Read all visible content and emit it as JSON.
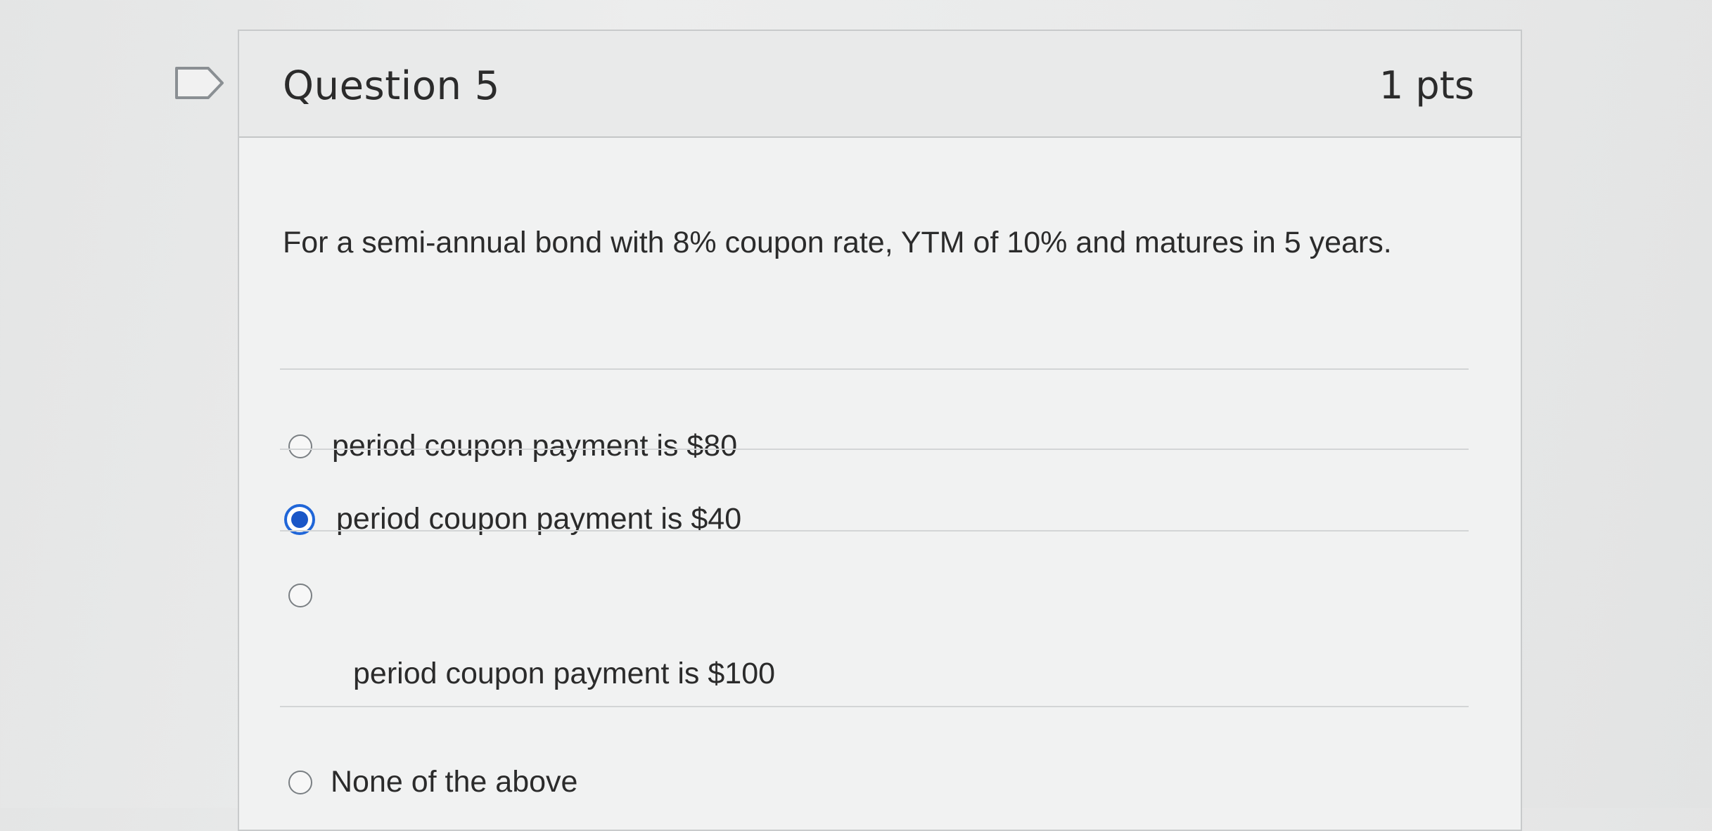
{
  "question": {
    "title": "Question 5",
    "points": "1 pts",
    "text": "For a semi-annual bond with 8% coupon rate, YTM of 10% and matures in 5 years."
  },
  "answers": [
    {
      "label": "period coupon payment is $80",
      "selected": false
    },
    {
      "label": "period coupon payment is $40",
      "selected": true
    },
    {
      "label": "period coupon payment is $100",
      "selected": false
    },
    {
      "label": "None of the above",
      "selected": false
    }
  ],
  "colors": {
    "accent": "#1a56c7",
    "text": "#2b2b2b",
    "border": "#c8cacb"
  },
  "icons": {
    "flag": "flag-outline-icon"
  }
}
